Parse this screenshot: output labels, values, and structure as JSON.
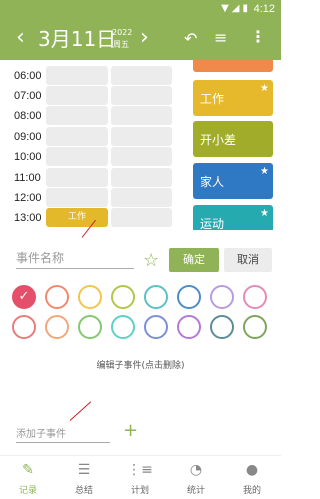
{
  "status_bar": {
    "time": "4:12"
  },
  "header": {
    "date": "3月11日",
    "year": "2022",
    "weekday": "周五",
    "prev_symbol": "‹",
    "next_symbol": "›"
  },
  "schedule": {
    "hours": [
      "06:00",
      "07:00",
      "08:00",
      "09:00",
      "10:00",
      "11:00",
      "12:00",
      "13:00"
    ],
    "event_label": "工作"
  },
  "categories": [
    {
      "label": "工作",
      "color": "#e6b92d",
      "starred": true
    },
    {
      "label": "开小差",
      "color": "#a1ad2a",
      "starred": false
    },
    {
      "label": "家人",
      "color": "#2f78c4",
      "starred": true
    },
    {
      "label": "运动",
      "color": "#25aab0",
      "starred": true
    }
  ],
  "event_form": {
    "name_placeholder": "事件名称",
    "ok_label": "确定",
    "cancel_label": "取消"
  },
  "colors": {
    "row1": [
      "#e4506a",
      "#f08a6e",
      "#f3c54d",
      "#b3c64a",
      "#5cc0c6",
      "#4f8bc5",
      "#b89ce0",
      "#e58bb5"
    ],
    "row2": [
      "#e87c7c",
      "#f5a67a",
      "#84c870",
      "#5ed1c5",
      "#7d8fd8",
      "#b37ad6",
      "#5c8c97",
      "#7fa55c"
    ]
  },
  "subevents": {
    "hint": "编辑子事件(点击删除)",
    "add_placeholder": "添加子事件"
  },
  "tabs": [
    {
      "label": "记录",
      "active": true
    },
    {
      "label": "总结",
      "active": false
    },
    {
      "label": "计划",
      "active": false
    },
    {
      "label": "统计",
      "active": false
    },
    {
      "label": "我的",
      "active": false
    }
  ]
}
